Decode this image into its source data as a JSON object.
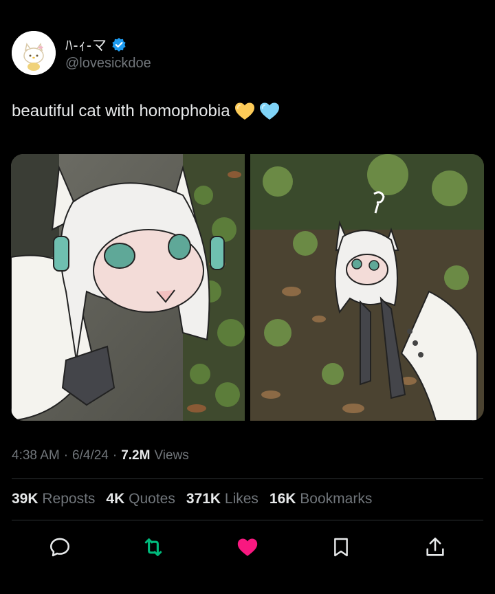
{
  "author": {
    "display_name": "ﾊ-ｨ-マ",
    "handle": "@lovesickdoe",
    "verified": true
  },
  "tweet": {
    "text": "beautiful cat with homophobia"
  },
  "meta": {
    "time": "4:38 AM",
    "date": "6/4/24",
    "views_count": "7.2M",
    "views_label": "Views"
  },
  "stats": [
    {
      "count": "39K",
      "label": "Reposts"
    },
    {
      "count": "4K",
      "label": "Quotes"
    },
    {
      "count": "371K",
      "label": "Likes"
    },
    {
      "count": "16K",
      "label": "Bookmarks"
    }
  ],
  "actions": [
    "reply-icon",
    "repost-icon",
    "like-icon",
    "bookmark-icon",
    "share-icon"
  ],
  "colors": {
    "background": "#000000",
    "text": "#e7e9ea",
    "muted": "#71767b",
    "verified": "#1d9bf0",
    "repost_active": "#00ba7c",
    "like_active": "#f91880"
  }
}
